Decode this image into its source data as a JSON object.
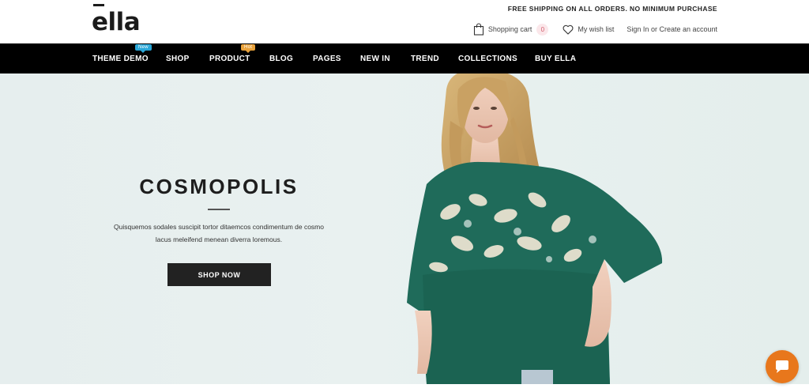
{
  "brand": {
    "logo": "ella"
  },
  "promo": {
    "text": "FREE SHIPPING ON ALL ORDERS. NO MINIMUM PURCHASE"
  },
  "header": {
    "cart_label": "Shopping cart",
    "cart_count": "0",
    "wishlist_label": "My wish list",
    "auth_label": "Sign In or Create an account"
  },
  "nav": {
    "items": [
      {
        "label": "THEME DEMO",
        "badge": "New"
      },
      {
        "label": "SHOP"
      },
      {
        "label": "PRODUCT",
        "badge": "Hot"
      },
      {
        "label": "BLOG"
      },
      {
        "label": "PAGES"
      },
      {
        "label": "NEW IN"
      },
      {
        "label": "TREND"
      },
      {
        "label": "COLLECTIONS"
      },
      {
        "label": "BUY ELLA"
      }
    ]
  },
  "hero": {
    "title": "COSMOPOLIS",
    "text": "Quisquemos sodales suscipit tortor ditaemcos condimentum de cosmo lacus meleifend menean diverra loremous.",
    "button": "SHOP NOW"
  },
  "icons": {
    "cart": "shopping-bag-icon",
    "wishlist": "heart-icon",
    "chat": "chat-icon"
  },
  "colors": {
    "nav_bg": "#000000",
    "badge_new": "#2aa7d8",
    "badge_hot": "#e9a23b",
    "hero_bg": "#e7efee",
    "button_bg": "#222222",
    "chat_bg": "#e8771c",
    "cart_badge_bg": "#fbe7ea"
  }
}
